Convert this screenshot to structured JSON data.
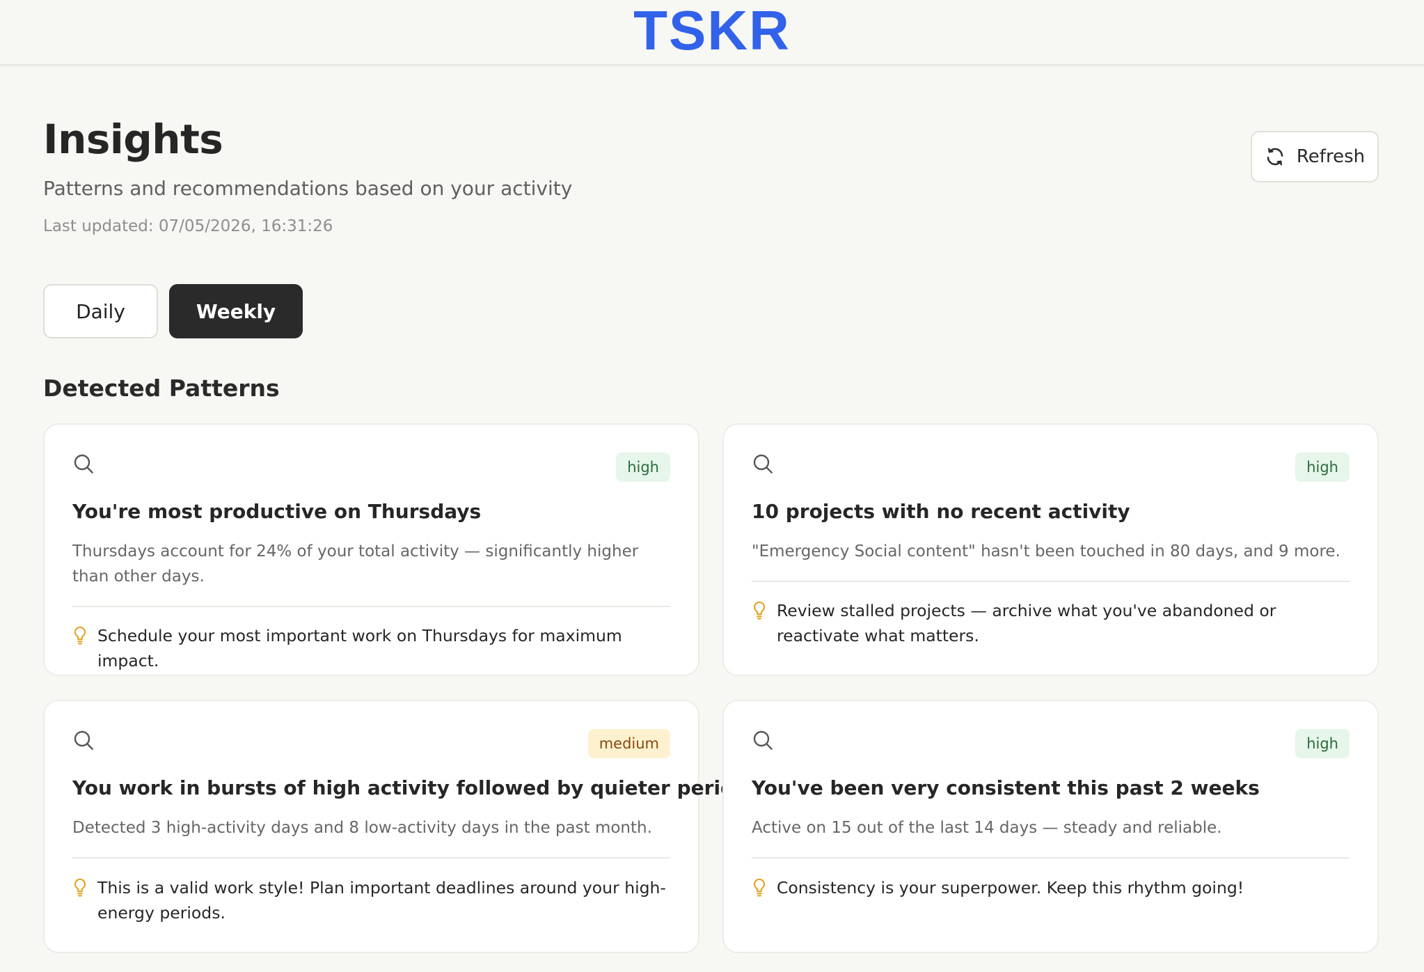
{
  "header": {
    "logo_text": "TSKR"
  },
  "page": {
    "title": "Insights",
    "subtitle": "Patterns and recommendations based on your activity",
    "last_updated": "Last updated: 07/05/2026, 16:31:26"
  },
  "refresh": {
    "label": "Refresh",
    "icon": "refresh-icon"
  },
  "tabs": [
    {
      "label": "Daily",
      "active": false
    },
    {
      "label": "Weekly",
      "active": true
    }
  ],
  "section": {
    "title": "Detected Patterns"
  },
  "cards": [
    {
      "icon": "search-icon",
      "badge": "high",
      "title": "You're most productive on Thursdays",
      "description": "Thursdays account for 24% of your total activity — significantly higher than other days.",
      "tip_icon": "lightbulb-icon",
      "tip": "Schedule your most important work on Thursdays for maximum impact."
    },
    {
      "icon": "search-icon",
      "badge": "high",
      "title": "10 projects with no recent activity",
      "description": "\"Emergency Social content\" hasn't been touched in 80 days, and 9 more.",
      "tip_icon": "lightbulb-icon",
      "tip": "Review stalled projects — archive what you've abandoned or reactivate what matters."
    },
    {
      "icon": "search-icon",
      "badge": "medium",
      "title": "You work in bursts of high activity followed by quieter periods",
      "description": "Detected 3 high-activity days and 8 low-activity days in the past month.",
      "tip_icon": "lightbulb-icon",
      "tip": "This is a valid work style! Plan important deadlines around your high-energy periods."
    },
    {
      "icon": "search-icon",
      "badge": "high",
      "title": "You've been very consistent this past 2 weeks",
      "description": "Active on 15 out of the last 14 days — steady and reliable.",
      "tip_icon": "lightbulb-icon",
      "tip": "Consistency is your superpower. Keep this rhythm going!"
    }
  ],
  "colors": {
    "brand": "#3262ea",
    "background": "#f7f7f4",
    "badge_high_bg": "#e6f6ea",
    "badge_high_text": "#2d6b3e",
    "badge_medium_bg": "#fdf1cf",
    "badge_medium_text": "#8a4a12",
    "tip_icon": "#e3a11b"
  }
}
